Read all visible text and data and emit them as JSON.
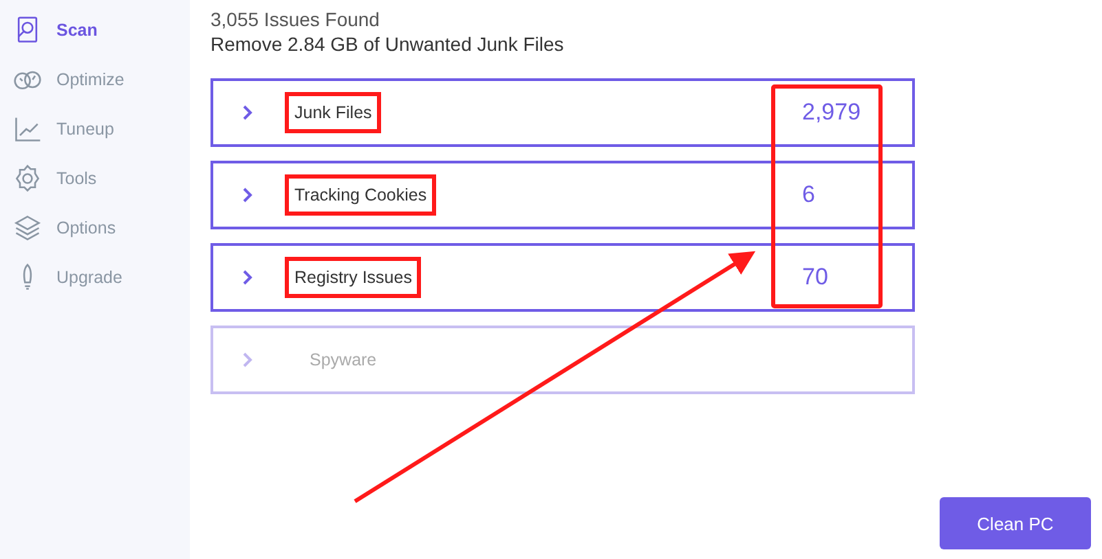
{
  "sidebar": {
    "items": [
      {
        "label": "Scan",
        "selected": true
      },
      {
        "label": "Optimize",
        "selected": false
      },
      {
        "label": "Tuneup",
        "selected": false
      },
      {
        "label": "Tools",
        "selected": false
      },
      {
        "label": "Options",
        "selected": false
      },
      {
        "label": "Upgrade",
        "selected": false
      }
    ]
  },
  "summary": {
    "issues": "3,055 Issues Found",
    "remove": "Remove  2.84 GB  of Unwanted Junk Files"
  },
  "results": [
    {
      "label": "Junk Files",
      "count": "2,979",
      "disabled": false,
      "highlighted": true
    },
    {
      "label": "Tracking Cookies",
      "count": "6",
      "disabled": false,
      "highlighted": true
    },
    {
      "label": "Registry Issues",
      "count": "70",
      "disabled": false,
      "highlighted": true
    },
    {
      "label": "Spyware",
      "disabled": true,
      "highlighted": false
    }
  ],
  "annotations": {
    "counts_box": true,
    "arrow": true
  },
  "clean_button": "Clean PC"
}
